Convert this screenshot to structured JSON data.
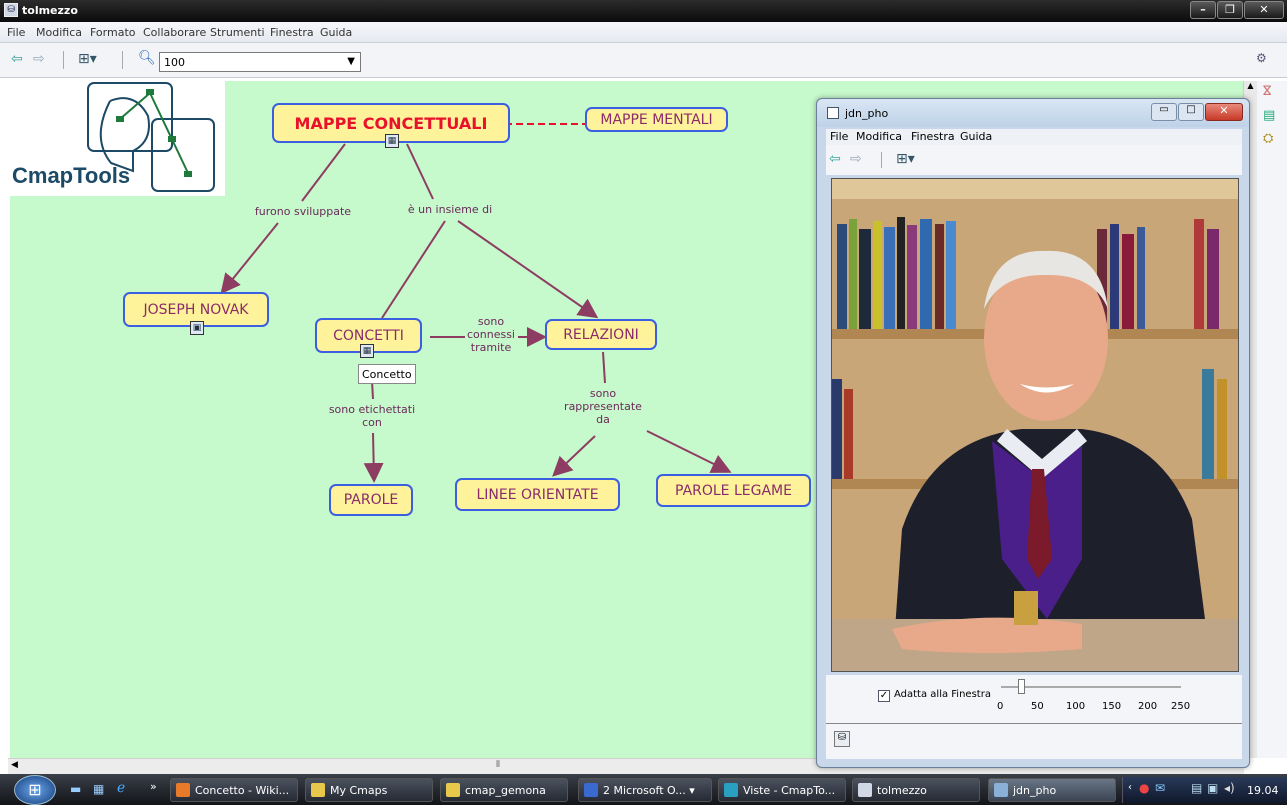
{
  "app": {
    "title": "tolmezzo"
  },
  "menu": [
    "File",
    "Modifica",
    "Formato",
    "Collaborare",
    "Strumenti",
    "Finestra",
    "Guida"
  ],
  "toolbar": {
    "zoom": "100"
  },
  "logo": {
    "text": "CmapTools"
  },
  "map": {
    "nodes": {
      "main": "MAPPE CONCETTUALI",
      "mentali": "MAPPE MENTALI",
      "novak": "JOSEPH NOVAK",
      "concetti": "CONCETTI",
      "relazioni": "RELAZIONI",
      "parole": "PAROLE",
      "linee": "LINEE ORIENTATE",
      "legame": "PAROLE LEGAME"
    },
    "links": {
      "sviluppate": "furono sviluppate",
      "insieme": "è un insieme di",
      "connessi": "sono connessi tramite",
      "etichettati": "sono etichettati con",
      "rappresentate": "sono rappresentate da"
    },
    "tooltip": "Concetto",
    "colors": {
      "node_fill": "#fef39a",
      "node_border": "#3b5fe0",
      "node_text": "#8a2c6a",
      "main_text": "#e8122a",
      "link": "#8e3d62",
      "background": "#c6f9cc"
    }
  },
  "viewer": {
    "title": "jdn_pho",
    "menu": [
      "File",
      "Modifica",
      "Finestra",
      "Guida"
    ],
    "fit_label": "Adatta alla Finestra",
    "fit_checked": true,
    "zoom_ticks": [
      "0",
      "50",
      "100",
      "150",
      "200",
      "250"
    ]
  },
  "taskbar": {
    "items": [
      "Concetto - Wiki...",
      "My Cmaps",
      "cmap_gemona",
      "2 Microsoft O...",
      "Viste - CmapTo...",
      "tolmezzo",
      "jdn_pho"
    ],
    "clock": "19.04"
  }
}
